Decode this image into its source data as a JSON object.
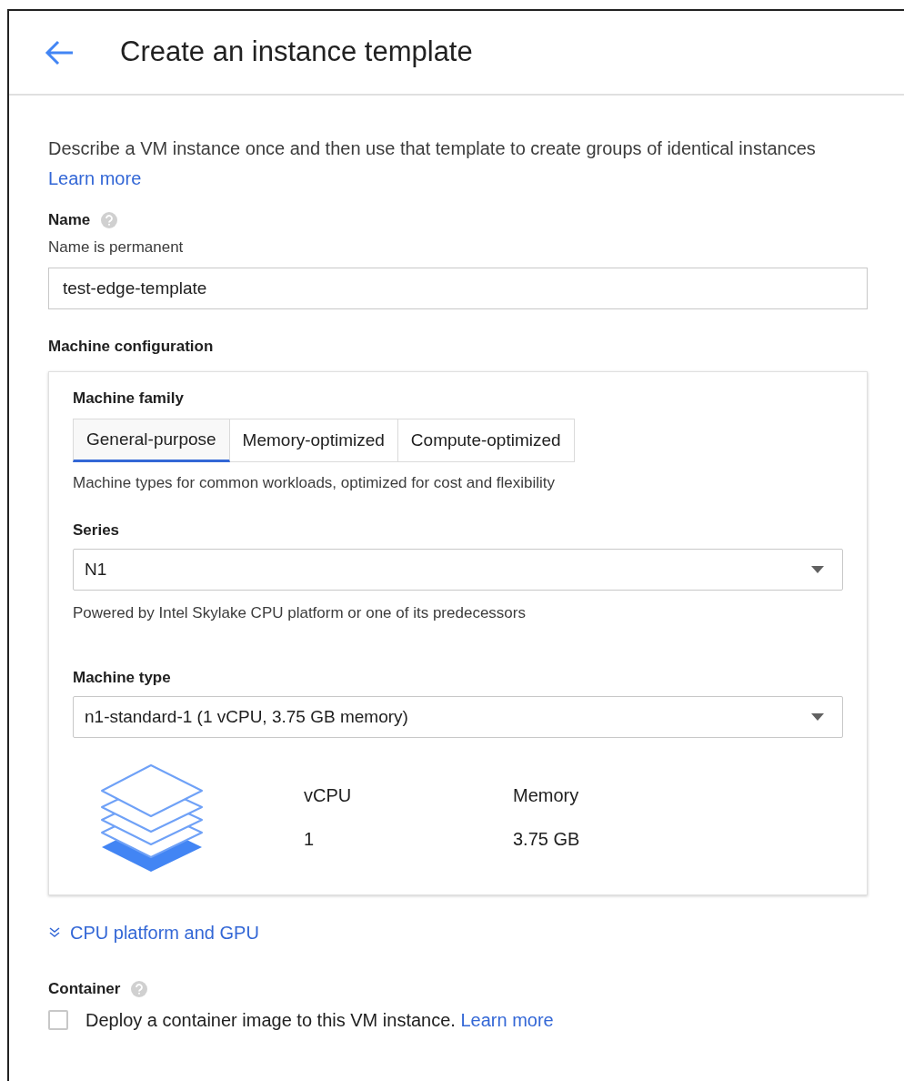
{
  "header": {
    "title": "Create an instance template"
  },
  "intro": {
    "text": "Describe a VM instance once and then use that template to create groups of identical instances",
    "link": "Learn more"
  },
  "name_field": {
    "label": "Name",
    "hint": "Name is permanent",
    "value": "test-edge-template"
  },
  "machine_configuration": {
    "title": "Machine configuration",
    "family_label": "Machine family",
    "tabs": [
      {
        "label": "General-purpose",
        "selected": true
      },
      {
        "label": "Memory-optimized",
        "selected": false
      },
      {
        "label": "Compute-optimized",
        "selected": false
      }
    ],
    "family_description": "Machine types for common workloads, optimized for cost and flexibility",
    "series": {
      "label": "Series",
      "value": "N1",
      "hint": "Powered by Intel Skylake CPU platform or one of its predecessors"
    },
    "machine_type": {
      "label": "Machine type",
      "value": "n1-standard-1 (1 vCPU, 3.75 GB memory)"
    },
    "specs": [
      {
        "label": "vCPU",
        "value": "1"
      },
      {
        "label": "Memory",
        "value": "3.75 GB"
      }
    ]
  },
  "cpu_platform_link": {
    "label": "CPU platform and GPU",
    "expanded": false
  },
  "container": {
    "label": "Container",
    "checkbox": {
      "checked": false,
      "text": "Deploy a container image to this VM instance.",
      "link": "Learn more"
    }
  }
}
